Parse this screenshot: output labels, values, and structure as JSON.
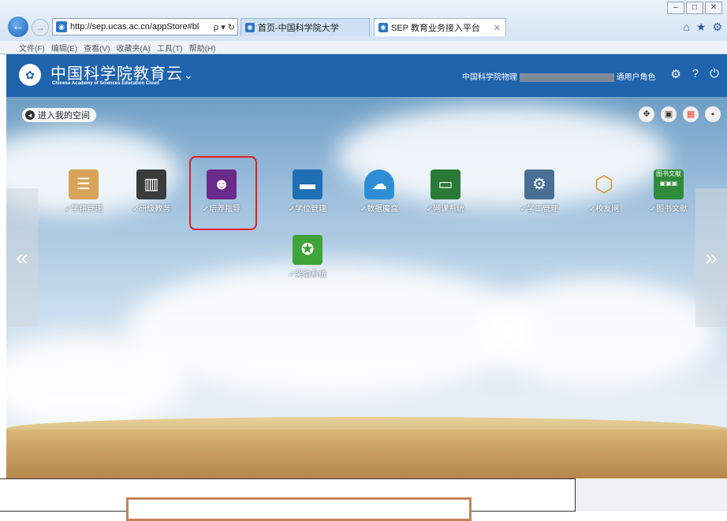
{
  "browser": {
    "url": "http://sep.ucas.ac.cn/appStore#bl",
    "address_controls": "ρ ▾ ↻",
    "tabs": [
      {
        "label": "首页-中国科学院大学"
      },
      {
        "label": "SEP 教育业务接入平台"
      }
    ],
    "menu": [
      "文件(F)",
      "编辑(E)",
      "查看(V)",
      "收藏夹(A)",
      "工具(T)",
      "帮助(H)"
    ]
  },
  "site": {
    "logo_cn": "中国科学院教育云",
    "logo_en": "Chinese Academy of Sciences Education Cloud",
    "user_prefix": "中国科学院物理",
    "user_suffix": "通用户角色"
  },
  "workspace": {
    "enter_space": "进入我的空间",
    "apps": [
      {
        "label": "✓学籍管理",
        "icon": "student-record-icon",
        "color": "#d9a35a"
      },
      {
        "label": "✓研级教务",
        "icon": "building-icon",
        "color": "#3b3b3b"
      },
      {
        "label": "✓培养指导",
        "icon": "head-brain-icon",
        "color": "#6a2a8a"
      },
      {
        "label": "✓学位管理",
        "icon": "graduation-cap-icon",
        "color": "#1f6fb5"
      },
      {
        "label": "✓数据魔盒",
        "icon": "cloud-box-icon",
        "color": "#2f8fd6"
      },
      {
        "label": "✓网课系统",
        "icon": "computer-icon",
        "color": "#2b7a38"
      },
      {
        "label": "✓学工管理",
        "icon": "settings-person-icon",
        "color": "#4a6f95"
      },
      {
        "label": "✓校友网",
        "icon": "network-ring-icon",
        "color": "#e0952a"
      },
      {
        "label": "✓图书文献",
        "icon": "library-icon",
        "color": "#2f8a3a"
      },
      {
        "label": "✓奖助系统",
        "icon": "award-icon",
        "color": "#3fa43a"
      }
    ],
    "library_badge": "图书文献"
  },
  "glyphs": {
    "back": "←",
    "fwd": "→",
    "left": "«",
    "right": "»",
    "home": "⌂",
    "star": "★",
    "gear": "⚙",
    "chevron": "⌄",
    "help": "?",
    "power": "⏻",
    "move": "✥",
    "image": "▣",
    "grid": "▦",
    "list": "▪",
    "dot": "◂"
  }
}
